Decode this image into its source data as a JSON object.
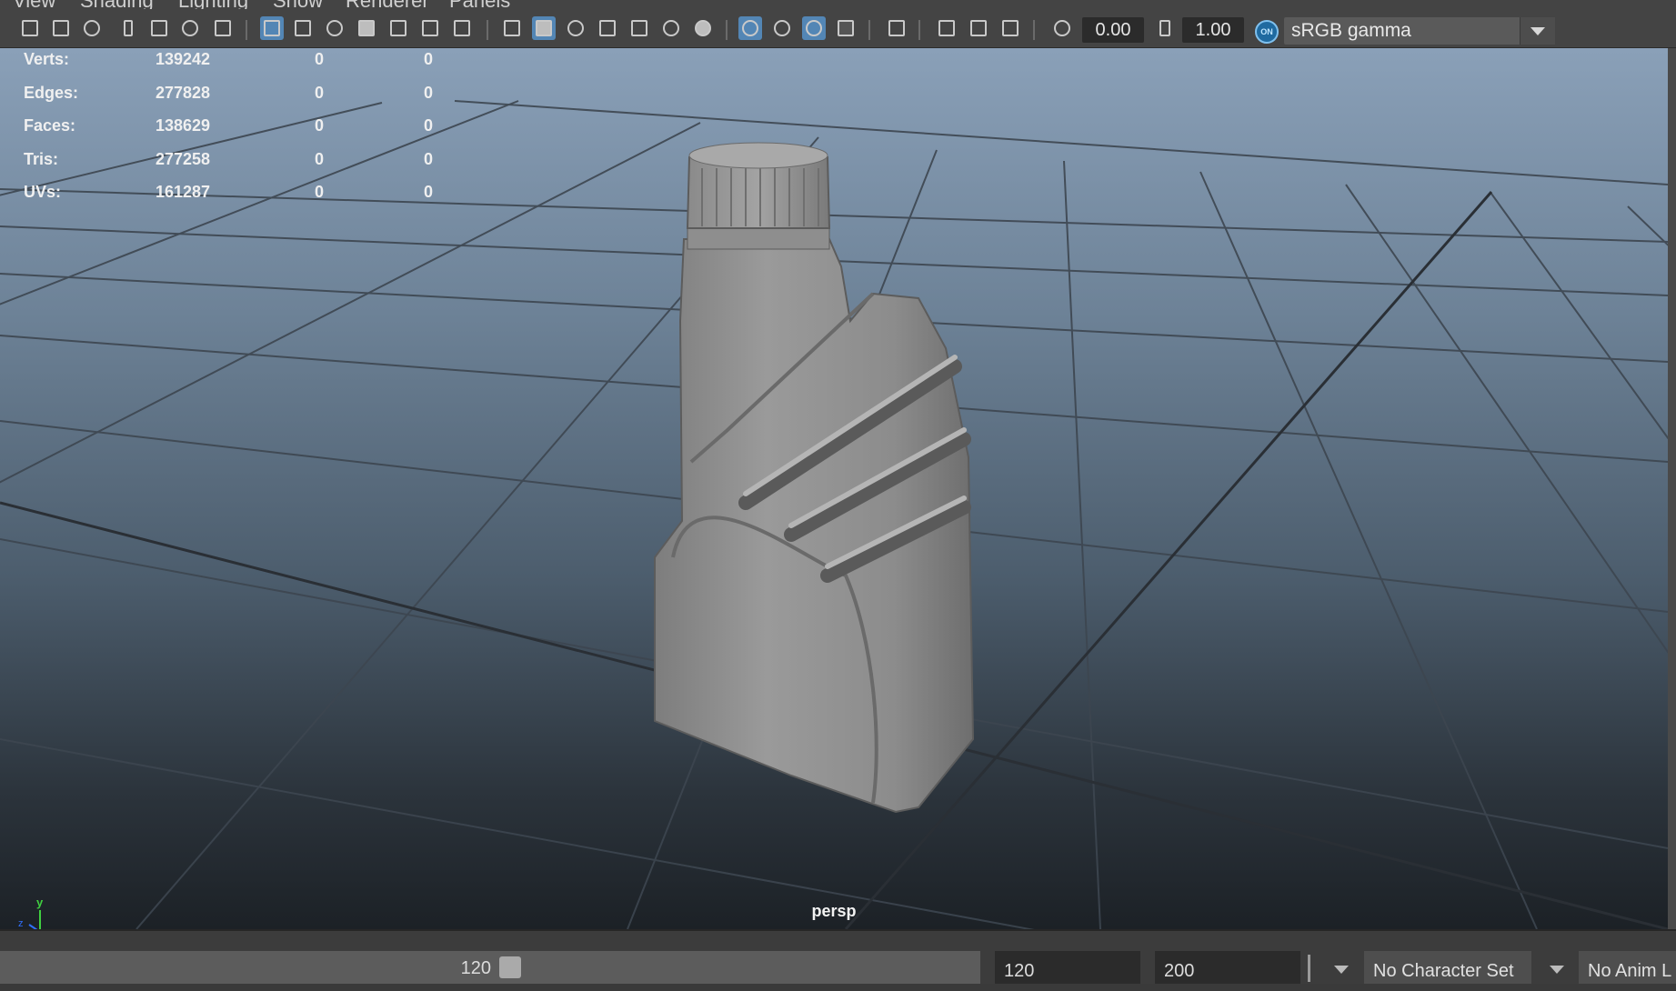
{
  "menu": {
    "items": [
      "View",
      "Shading",
      "Lighting",
      "Show",
      "Renderer",
      "Panels"
    ]
  },
  "toolbar": {
    "icons": [
      "camera-icon",
      "camera-attributes-icon",
      "bookmark-camera-icon",
      "bookmark-icon",
      "image-plane-icon",
      "grease-pencil-icon",
      "paint-icon",
      "grid-icon",
      "film-gate-icon",
      "resolution-gate-icon",
      "gate-mask-icon",
      "field-chart-icon",
      "safe-action-icon",
      "safe-title-icon",
      "wireframe-icon",
      "smooth-shade-icon",
      "default-material-icon",
      "wireframe-on-shaded-icon",
      "xray-icon",
      "lights-icon",
      "shadows-icon",
      "ambient-occlusion-icon",
      "motion-blur-icon",
      "antialias-icon",
      "depth-of-field-icon",
      "isolate-select-icon",
      "xray-joints-icon",
      "xray-active-icon",
      "backface-icon",
      "exposure-icon",
      "gamma-icon",
      "color-management-icon"
    ],
    "exposure_value": "0.00",
    "gamma_value": "1.00",
    "cm_on_label": "ON",
    "color_space": "sRGB gamma"
  },
  "hud": {
    "rows": [
      {
        "label": "Verts:",
        "v1": "139242",
        "v2": "0",
        "v3": "0"
      },
      {
        "label": "Edges:",
        "v1": "277828",
        "v2": "0",
        "v3": "0"
      },
      {
        "label": "Faces:",
        "v1": "138629",
        "v2": "0",
        "v3": "0"
      },
      {
        "label": "Tris:",
        "v1": "277258",
        "v2": "0",
        "v3": "0"
      },
      {
        "label": "UVs:",
        "v1": "161287",
        "v2": "0",
        "v3": "0"
      }
    ]
  },
  "viewport": {
    "camera": "persp",
    "axis_y": "y",
    "axis_x": "x",
    "axis_z": "z"
  },
  "timebar": {
    "current_frame": "120",
    "end_time": "120",
    "playback_end": "200",
    "character_set": "No Character Set",
    "anim_layer": "No Anim L"
  },
  "colors": {
    "accent": "#5386b5",
    "viewport_top": "#8aa0b8",
    "viewport_bottom": "#1c2126",
    "axis_x": "#e03030",
    "axis_y": "#40d040",
    "axis_z": "#3070ff"
  }
}
